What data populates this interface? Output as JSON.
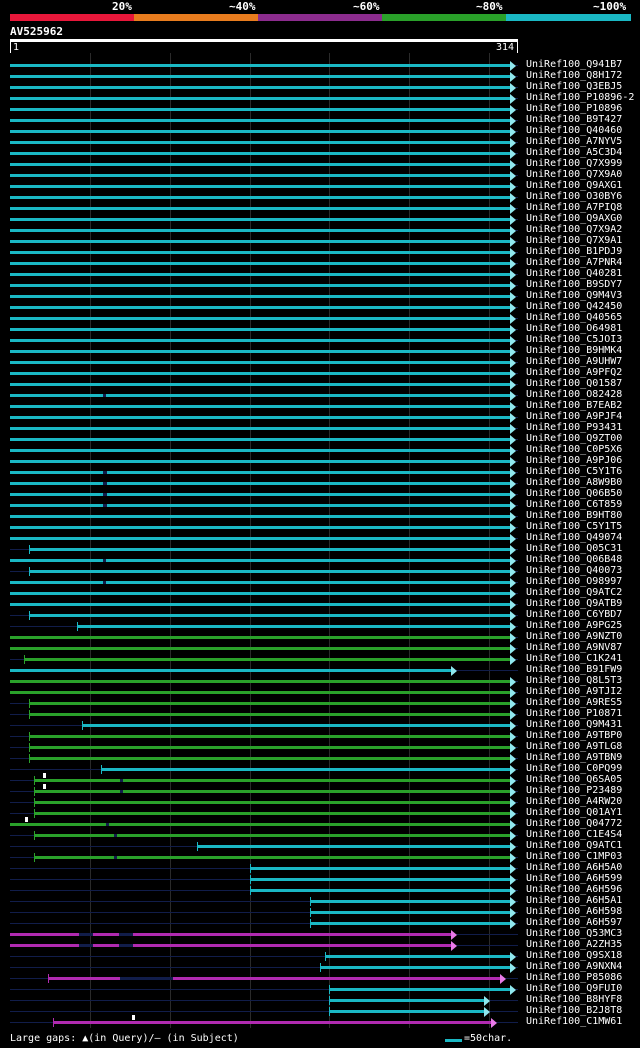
{
  "legend": {
    "labels": [
      "20%",
      "~40%",
      "~60%",
      "~80%",
      "~100%"
    ],
    "colors": [
      "#e8173a",
      "#e87c1e",
      "#8c2c8e",
      "#2aa12a",
      "#1ab8c4"
    ]
  },
  "query": {
    "name": "AV525962",
    "start": "1",
    "end": "314"
  },
  "colors": {
    "cyan": "#1ab8c4",
    "green": "#2aa12a",
    "purple": "#b02ab0",
    "gap": "#111d4a",
    "arrow": "#8fe8ee"
  },
  "footer": {
    "gaps_text": "Large gaps: ▲(in Query)/– (in Subject)",
    "scale_text": "=50char."
  },
  "hits": [
    {
      "name": "UniRef100_Q941B7",
      "c": "cyan",
      "s": 1,
      "e": 314
    },
    {
      "name": "UniRef100_Q8H172",
      "c": "cyan",
      "s": 1,
      "e": 314
    },
    {
      "name": "UniRef100_Q3EBJ5",
      "c": "cyan",
      "s": 1,
      "e": 314
    },
    {
      "name": "UniRef100_P10896-2",
      "c": "cyan",
      "s": 1,
      "e": 314
    },
    {
      "name": "UniRef100_P10896",
      "c": "cyan",
      "s": 1,
      "e": 314
    },
    {
      "name": "UniRef100_B9T427",
      "c": "cyan",
      "s": 1,
      "e": 314
    },
    {
      "name": "UniRef100_Q40460",
      "c": "cyan",
      "s": 1,
      "e": 314
    },
    {
      "name": "UniRef100_A7NYV5",
      "c": "cyan",
      "s": 1,
      "e": 314
    },
    {
      "name": "UniRef100_A5C3D4",
      "c": "cyan",
      "s": 1,
      "e": 314
    },
    {
      "name": "UniRef100_Q7X999",
      "c": "cyan",
      "s": 1,
      "e": 314
    },
    {
      "name": "UniRef100_Q7X9A0",
      "c": "cyan",
      "s": 1,
      "e": 314
    },
    {
      "name": "UniRef100_Q9AXG1",
      "c": "cyan",
      "s": 1,
      "e": 314
    },
    {
      "name": "UniRef100_O30BY6",
      "c": "cyan",
      "s": 1,
      "e": 314
    },
    {
      "name": "UniRef100_A7PIQ8",
      "c": "cyan",
      "s": 1,
      "e": 314
    },
    {
      "name": "UniRef100_Q9AXG0",
      "c": "cyan",
      "s": 1,
      "e": 314
    },
    {
      "name": "UniRef100_Q7X9A2",
      "c": "cyan",
      "s": 1,
      "e": 314
    },
    {
      "name": "UniRef100_Q7X9A1",
      "c": "cyan",
      "s": 1,
      "e": 314
    },
    {
      "name": "UniRef100_B1PDJ9",
      "c": "cyan",
      "s": 1,
      "e": 314
    },
    {
      "name": "UniRef100_A7PNR4",
      "c": "cyan",
      "s": 1,
      "e": 314
    },
    {
      "name": "UniRef100_Q40281",
      "c": "cyan",
      "s": 1,
      "e": 314
    },
    {
      "name": "UniRef100_B9SDY7",
      "c": "cyan",
      "s": 1,
      "e": 314
    },
    {
      "name": "UniRef100_Q9M4V3",
      "c": "cyan",
      "s": 1,
      "e": 314
    },
    {
      "name": "UniRef100_Q42450",
      "c": "cyan",
      "s": 1,
      "e": 314
    },
    {
      "name": "UniRef100_Q40565",
      "c": "cyan",
      "s": 1,
      "e": 314
    },
    {
      "name": "UniRef100_O64981",
      "c": "cyan",
      "s": 1,
      "e": 314
    },
    {
      "name": "UniRef100_C5JOI3",
      "c": "cyan",
      "s": 1,
      "e": 314
    },
    {
      "name": "UniRef100_B9HMK4",
      "c": "cyan",
      "s": 1,
      "e": 314
    },
    {
      "name": "UniRef100_A9UHW7",
      "c": "cyan",
      "s": 1,
      "e": 314
    },
    {
      "name": "UniRef100_A9PFQ2",
      "c": "cyan",
      "s": 1,
      "e": 314
    },
    {
      "name": "UniRef100_Q01587",
      "c": "cyan",
      "s": 1,
      "e": 314
    },
    {
      "name": "UniRef100_O82428",
      "c": "cyan",
      "s": 1,
      "e": 314,
      "g": [
        59,
        61
      ]
    },
    {
      "name": "UniRef100_B7EAB2",
      "c": "cyan",
      "s": 1,
      "e": 314
    },
    {
      "name": "UniRef100_A9PJF4",
      "c": "cyan",
      "s": 1,
      "e": 314
    },
    {
      "name": "UniRef100_P93431",
      "c": "cyan",
      "s": 1,
      "e": 314
    },
    {
      "name": "UniRef100_Q9ZT00",
      "c": "cyan",
      "s": 1,
      "e": 314
    },
    {
      "name": "UniRef100_C0P5X6",
      "c": "cyan",
      "s": 1,
      "e": 314
    },
    {
      "name": "UniRef100_A9PJ06",
      "c": "cyan",
      "s": 1,
      "e": 314
    },
    {
      "name": "UniRef100_C5Y1T6",
      "c": "cyan",
      "s": 1,
      "e": 314,
      "g": [
        59,
        62
      ]
    },
    {
      "name": "UniRef100_A8W9B0",
      "c": "cyan",
      "s": 1,
      "e": 314,
      "g": [
        59,
        62
      ]
    },
    {
      "name": "UniRef100_Q06B50",
      "c": "cyan",
      "s": 1,
      "e": 314,
      "g": [
        59,
        62
      ]
    },
    {
      "name": "UniRef100_C6T859",
      "c": "cyan",
      "s": 1,
      "e": 314,
      "g": [
        59,
        62
      ]
    },
    {
      "name": "UniRef100_B9HT80",
      "c": "cyan",
      "s": 1,
      "e": 314
    },
    {
      "name": "UniRef100_C5Y1T5",
      "c": "cyan",
      "s": 1,
      "e": 314
    },
    {
      "name": "UniRef100_Q49074",
      "c": "cyan",
      "s": 1,
      "e": 314
    },
    {
      "name": "UniRef100_Q05C31",
      "c": "cyan",
      "s": 13,
      "e": 314
    },
    {
      "name": "UniRef100_Q06B48",
      "c": "cyan",
      "s": 1,
      "e": 314,
      "g": [
        59,
        61
      ]
    },
    {
      "name": "UniRef100_Q40073",
      "c": "cyan",
      "s": 13,
      "e": 314
    },
    {
      "name": "UniRef100_O98997",
      "c": "cyan",
      "s": 1,
      "e": 314,
      "g": [
        59,
        61
      ]
    },
    {
      "name": "UniRef100_Q9ATC2",
      "c": "cyan",
      "s": 1,
      "e": 314
    },
    {
      "name": "UniRef100_Q9ATB9",
      "c": "cyan",
      "s": 1,
      "e": 314
    },
    {
      "name": "UniRef100_C6YBD7",
      "c": "cyan",
      "s": 13,
      "e": 314
    },
    {
      "name": "UniRef100_A9PG25",
      "c": "cyan",
      "s": 43,
      "e": 314
    },
    {
      "name": "UniRef100_A9NZT0",
      "c": "green",
      "s": 1,
      "e": 314
    },
    {
      "name": "UniRef100_A9NV87",
      "c": "green",
      "s": 1,
      "e": 314
    },
    {
      "name": "UniRef100_C1K241",
      "c": "green",
      "s": 10,
      "e": 314
    },
    {
      "name": "UniRef100_B91FW9",
      "c": "cyan",
      "s": 1,
      "e": 277
    },
    {
      "name": "UniRef100_Q8L5T3",
      "c": "green",
      "s": 1,
      "e": 314
    },
    {
      "name": "UniRef100_A9TJI2",
      "c": "green",
      "s": 1,
      "e": 314
    },
    {
      "name": "UniRef100_A9RES5",
      "c": "green",
      "s": 13,
      "e": 314
    },
    {
      "name": "UniRef100_P10871",
      "c": "green",
      "s": 13,
      "e": 314
    },
    {
      "name": "UniRef100_Q9M431",
      "c": "cyan",
      "s": 46,
      "e": 314
    },
    {
      "name": "UniRef100_A9TBP0",
      "c": "green",
      "s": 13,
      "e": 314
    },
    {
      "name": "UniRef100_A9TLG8",
      "c": "green",
      "s": 13,
      "e": 314
    },
    {
      "name": "UniRef100_A9TBN9",
      "c": "green",
      "s": 13,
      "e": 314
    },
    {
      "name": "UniRef100_C0PQ99",
      "c": "cyan",
      "s": 58,
      "e": 314
    },
    {
      "name": "UniRef100_Q6SA05",
      "c": "green",
      "s": 16,
      "e": 314,
      "g": [
        70,
        72
      ],
      "q": 22
    },
    {
      "name": "UniRef100_P23489",
      "c": "green",
      "s": 16,
      "e": 314,
      "g": [
        70,
        72
      ],
      "q": 22
    },
    {
      "name": "UniRef100_A4RW20",
      "c": "green",
      "s": 16,
      "e": 314
    },
    {
      "name": "UniRef100_Q01AY1",
      "c": "green",
      "s": 16,
      "e": 314
    },
    {
      "name": "UniRef100_Q04772",
      "c": "green",
      "s": 1,
      "e": 314,
      "g": [
        61,
        63
      ],
      "q": 11
    },
    {
      "name": "UniRef100_C1E4S4",
      "c": "green",
      "s": 16,
      "e": 314,
      "g": [
        66,
        68
      ]
    },
    {
      "name": "UniRef100_Q9ATC1",
      "c": "cyan",
      "s": 118,
      "e": 314
    },
    {
      "name": "UniRef100_C1MP03",
      "c": "green",
      "s": 16,
      "e": 314,
      "g": [
        66,
        68
      ]
    },
    {
      "name": "UniRef100_A6H5A0",
      "c": "cyan",
      "s": 151,
      "e": 314
    },
    {
      "name": "UniRef100_A6H599",
      "c": "cyan",
      "s": 151,
      "e": 314
    },
    {
      "name": "UniRef100_A6H596",
      "c": "cyan",
      "s": 151,
      "e": 314
    },
    {
      "name": "UniRef100_A6H5A1",
      "c": "cyan",
      "s": 189,
      "e": 314
    },
    {
      "name": "UniRef100_A6H598",
      "c": "cyan",
      "s": 189,
      "e": 314
    },
    {
      "name": "UniRef100_A6H597",
      "c": "cyan",
      "s": 189,
      "e": 314
    },
    {
      "name": "UniRef100_Q53MC3",
      "c": "purple",
      "s": 1,
      "e": 277,
      "g": [
        44,
        53
      ],
      "g2": [
        69,
        78
      ]
    },
    {
      "name": "UniRef100_A2ZH35",
      "c": "purple",
      "s": 1,
      "e": 277,
      "g": [
        44,
        53
      ],
      "g2": [
        69,
        78
      ]
    },
    {
      "name": "UniRef100_Q9SX18",
      "c": "cyan",
      "s": 198,
      "e": 314
    },
    {
      "name": "UniRef100_A9NXN4",
      "c": "cyan",
      "s": 195,
      "e": 314
    },
    {
      "name": "UniRef100_P85086",
      "c": "purple",
      "s": 25,
      "e": 308,
      "g": [
        70,
        103
      ]
    },
    {
      "name": "UniRef100_Q9FUI0",
      "c": "cyan",
      "s": 201,
      "e": 314
    },
    {
      "name": "UniRef100_B8HYF8",
      "c": "cyan",
      "s": 201,
      "e": 298
    },
    {
      "name": "UniRef100_B2J8T8",
      "c": "cyan",
      "s": 201,
      "e": 298
    },
    {
      "name": "UniRef100_C1MW61",
      "c": "purple",
      "s": 28,
      "e": 302,
      "q": 78
    }
  ]
}
